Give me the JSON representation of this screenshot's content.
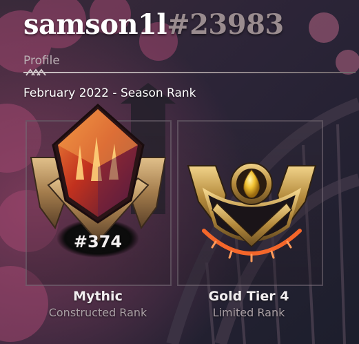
{
  "profile": {
    "username": "samson1l",
    "tag": "#23983",
    "section_label": "Profile",
    "season_label": "February 2022 - Season Rank"
  },
  "ranks": [
    {
      "name": "Mythic",
      "type": "Constructed Rank",
      "position": "#374",
      "emblem": "mythic-rank-emblem-icon"
    },
    {
      "name": "Gold Tier 4",
      "type": "Limited Rank",
      "emblem": "gold-rank-emblem-icon",
      "progress_pips_filled": 4,
      "progress_pips_total": 4
    }
  ],
  "colors": {
    "mythic_core": "#e0502a",
    "gold": "#d9b44a",
    "progress_glow": "#ff6a2a",
    "frame_bronze": "#b08a5a"
  }
}
